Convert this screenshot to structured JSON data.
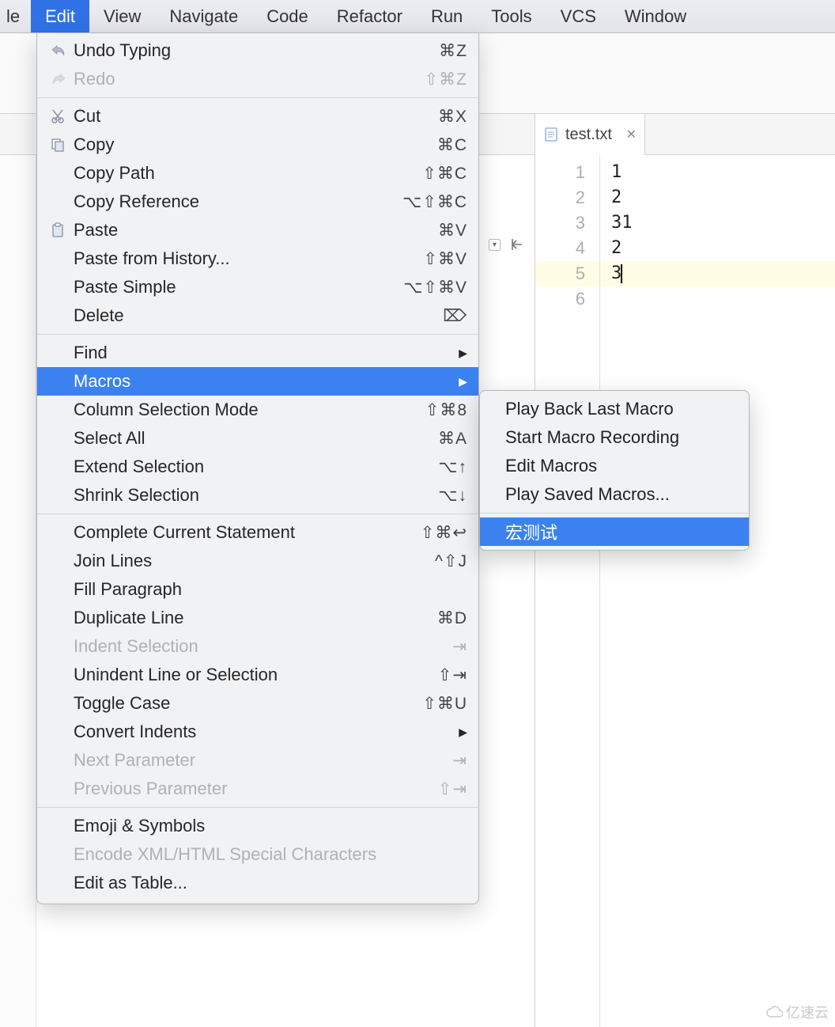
{
  "menubar": {
    "items": [
      "le",
      "Edit",
      "View",
      "Navigate",
      "Code",
      "Refactor",
      "Run",
      "Tools",
      "VCS",
      "Window"
    ],
    "selected_index": 1
  },
  "edit_menu": {
    "groups": [
      [
        {
          "icon": "undo-icon",
          "label": "Undo Typing",
          "shortcut": "⌘Z",
          "enabled": true
        },
        {
          "icon": "redo-icon",
          "label": "Redo",
          "shortcut": "⇧⌘Z",
          "enabled": false
        }
      ],
      [
        {
          "icon": "cut-icon",
          "label": "Cut",
          "shortcut": "⌘X",
          "enabled": true
        },
        {
          "icon": "copy-icon",
          "label": "Copy",
          "shortcut": "⌘C",
          "enabled": true
        },
        {
          "icon": "",
          "label": "Copy Path",
          "shortcut": "⇧⌘C",
          "enabled": true
        },
        {
          "icon": "",
          "label": "Copy Reference",
          "shortcut": "⌥⇧⌘C",
          "enabled": true
        },
        {
          "icon": "paste-icon",
          "label": "Paste",
          "shortcut": "⌘V",
          "enabled": true
        },
        {
          "icon": "",
          "label": "Paste from History...",
          "shortcut": "⇧⌘V",
          "enabled": true
        },
        {
          "icon": "",
          "label": "Paste Simple",
          "shortcut": "⌥⇧⌘V",
          "enabled": true
        },
        {
          "icon": "",
          "label": "Delete",
          "shortcut": "⌦",
          "enabled": true
        }
      ],
      [
        {
          "icon": "",
          "label": "Find",
          "shortcut": "",
          "enabled": true,
          "submenu": true
        },
        {
          "icon": "",
          "label": "Macros",
          "shortcut": "",
          "enabled": true,
          "submenu": true,
          "highlight": true
        },
        {
          "icon": "",
          "label": "Column Selection Mode",
          "shortcut": "⇧⌘8",
          "enabled": true
        },
        {
          "icon": "",
          "label": "Select All",
          "shortcut": "⌘A",
          "enabled": true
        },
        {
          "icon": "",
          "label": "Extend Selection",
          "shortcut": "⌥↑",
          "enabled": true
        },
        {
          "icon": "",
          "label": "Shrink Selection",
          "shortcut": "⌥↓",
          "enabled": true
        }
      ],
      [
        {
          "icon": "",
          "label": "Complete Current Statement",
          "shortcut": "⇧⌘↩",
          "enabled": true
        },
        {
          "icon": "",
          "label": "Join Lines",
          "shortcut": "^⇧J",
          "enabled": true
        },
        {
          "icon": "",
          "label": "Fill Paragraph",
          "shortcut": "",
          "enabled": true
        },
        {
          "icon": "",
          "label": "Duplicate Line",
          "shortcut": "⌘D",
          "enabled": true
        },
        {
          "icon": "",
          "label": "Indent Selection",
          "shortcut": "⇥",
          "enabled": false
        },
        {
          "icon": "",
          "label": "Unindent Line or Selection",
          "shortcut": "⇧⇥",
          "enabled": true
        },
        {
          "icon": "",
          "label": "Toggle Case",
          "shortcut": "⇧⌘U",
          "enabled": true
        },
        {
          "icon": "",
          "label": "Convert Indents",
          "shortcut": "",
          "enabled": true,
          "submenu": true
        },
        {
          "icon": "",
          "label": "Next Parameter",
          "shortcut": "⇥",
          "enabled": false
        },
        {
          "icon": "",
          "label": "Previous Parameter",
          "shortcut": "⇧⇥",
          "enabled": false
        }
      ],
      [
        {
          "icon": "",
          "label": "Emoji & Symbols",
          "shortcut": "",
          "enabled": true
        },
        {
          "icon": "",
          "label": "Encode XML/HTML Special Characters",
          "shortcut": "",
          "enabled": false
        },
        {
          "icon": "",
          "label": "Edit as Table...",
          "shortcut": "",
          "enabled": true
        }
      ]
    ]
  },
  "macros_submenu": {
    "items": [
      {
        "label": "Play Back Last Macro"
      },
      {
        "label": "Start Macro Recording"
      },
      {
        "label": "Edit Macros"
      },
      {
        "label": "Play Saved Macros..."
      }
    ],
    "extra": [
      {
        "label": "宏测试",
        "highlight": true
      }
    ]
  },
  "editor": {
    "tab_label": "test.txt",
    "lines": [
      {
        "n": "1",
        "text": "1"
      },
      {
        "n": "2",
        "text": "2"
      },
      {
        "n": "3",
        "text": "31"
      },
      {
        "n": "4",
        "text": "2"
      },
      {
        "n": "5",
        "text": "3",
        "active": true,
        "caret": true
      },
      {
        "n": "6",
        "text": ""
      }
    ]
  },
  "watermark": "亿速云"
}
